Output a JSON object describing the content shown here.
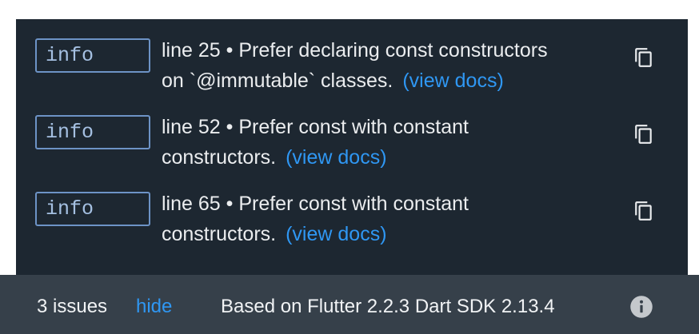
{
  "issues": [
    {
      "severity": "info",
      "line1": "line 25 • Prefer declaring const constructors",
      "line2": "on `@immutable` classes.",
      "docs_label": "(view docs)",
      "copy_icon": "copy-icon"
    },
    {
      "severity": "info",
      "line1": "line 52 • Prefer const with constant",
      "line2": "constructors.",
      "docs_label": "(view docs)",
      "copy_icon": "copy-icon"
    },
    {
      "severity": "info",
      "line1": "line 65 • Prefer const with constant",
      "line2": "constructors.",
      "docs_label": "(view docs)",
      "copy_icon": "copy-icon"
    }
  ],
  "footer": {
    "issue_count": "3 issues",
    "hide_label": "hide",
    "version_text": "Based on Flutter 2.2.3 Dart SDK 2.13.4",
    "info_icon": "info-icon"
  },
  "colors": {
    "panel_background": "#1d2731",
    "footer_background": "#36404a",
    "badge_border": "#6d93c6",
    "link": "#2f97f3",
    "text": "#ebedef"
  }
}
